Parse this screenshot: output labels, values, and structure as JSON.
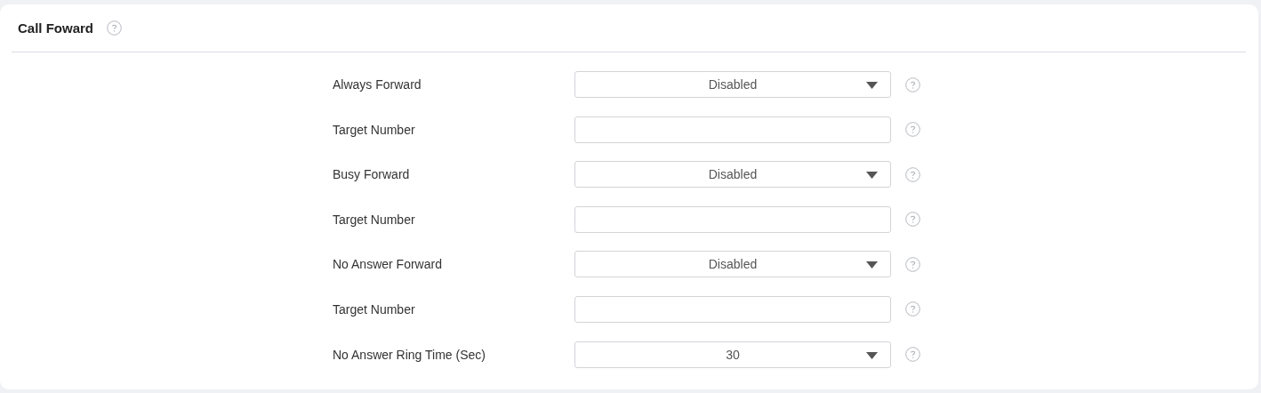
{
  "section": {
    "title": "Call Foward"
  },
  "rows": [
    {
      "label": "Always Forward",
      "kind": "select",
      "value": "Disabled"
    },
    {
      "label": "Target Number",
      "kind": "text"
    },
    {
      "label": "Busy Forward",
      "kind": "select",
      "value": "Disabled"
    },
    {
      "label": "Target Number",
      "kind": "text"
    },
    {
      "label": "No Answer Forward",
      "kind": "select",
      "value": "Disabled"
    },
    {
      "label": "Target Number",
      "kind": "text"
    },
    {
      "label": "No Answer Ring Time (Sec)",
      "kind": "select",
      "value": "30"
    }
  ]
}
